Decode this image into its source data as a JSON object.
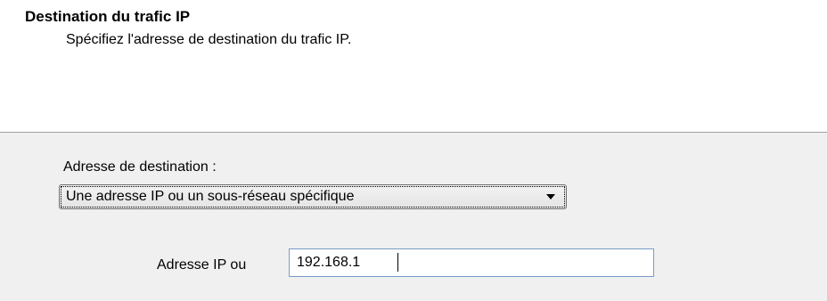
{
  "header": {
    "title": "Destination du trafic IP",
    "subtitle": "Spécifiez l'adresse de destination du trafic IP."
  },
  "destination": {
    "label": "Adresse de destination :",
    "selected": "Une adresse IP ou un sous-réseau spécifique"
  },
  "ip_field": {
    "label": "Adresse IP ou",
    "value": "192.168.1"
  },
  "colors": {
    "content_background": "#f0f0f0",
    "header_background": "#ffffff",
    "input_border": "#7a9cc6"
  },
  "icons": {
    "dropdown": "chevron-down-icon"
  }
}
